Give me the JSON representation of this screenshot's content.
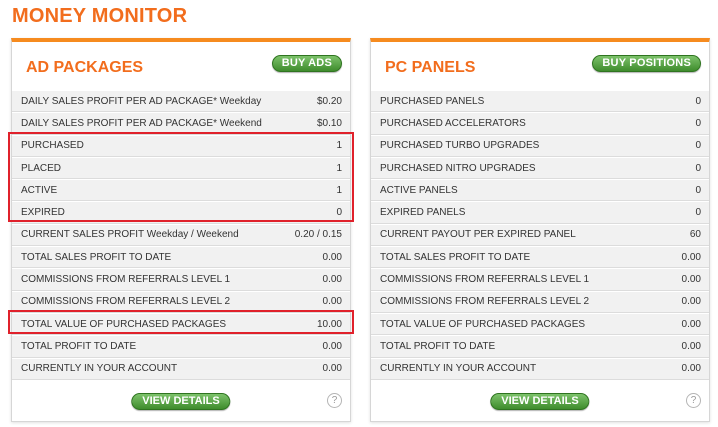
{
  "title": "MONEY MONITOR",
  "ad_packages": {
    "title": "AD PACKAGES",
    "buy_label": "BUY ADS",
    "rows": [
      {
        "label": "DAILY SALES PROFIT PER AD PACKAGE* Weekday",
        "value": "$0.20"
      },
      {
        "label": "DAILY SALES PROFIT PER AD PACKAGE* Weekend",
        "value": "$0.10"
      },
      {
        "label": "PURCHASED",
        "value": "1"
      },
      {
        "label": "PLACED",
        "value": "1"
      },
      {
        "label": "ACTIVE",
        "value": "1"
      },
      {
        "label": "EXPIRED",
        "value": "0"
      },
      {
        "label": "CURRENT SALES PROFIT Weekday / Weekend",
        "value": "0.20 / 0.15"
      },
      {
        "label": "TOTAL SALES PROFIT TO DATE",
        "value": "0.00"
      },
      {
        "label": "COMMISSIONS FROM REFERRALS LEVEL 1",
        "value": "0.00"
      },
      {
        "label": "COMMISSIONS FROM REFERRALS LEVEL 2",
        "value": "0.00"
      },
      {
        "label": "TOTAL VALUE OF PURCHASED PACKAGES",
        "value": "10.00"
      },
      {
        "label": "TOTAL PROFIT TO DATE",
        "value": "0.00"
      },
      {
        "label": "CURRENTLY IN YOUR ACCOUNT",
        "value": "0.00"
      }
    ],
    "details_label": "VIEW DETAILS",
    "help_glyph": "?"
  },
  "pc_panels": {
    "title": "PC PANELS",
    "buy_label": "BUY POSITIONS",
    "rows": [
      {
        "label": "PURCHASED PANELS",
        "value": "0"
      },
      {
        "label": "PURCHASED ACCELERATORS",
        "value": "0"
      },
      {
        "label": "PURCHASED TURBO UPGRADES",
        "value": "0"
      },
      {
        "label": "PURCHASED NITRO UPGRADES",
        "value": "0"
      },
      {
        "label": "ACTIVE PANELS",
        "value": "0"
      },
      {
        "label": "EXPIRED PANELS",
        "value": "0"
      },
      {
        "label": "CURRENT PAYOUT PER EXPIRED PANEL",
        "value": "60"
      },
      {
        "label": "TOTAL SALES PROFIT TO DATE",
        "value": "0.00"
      },
      {
        "label": "COMMISSIONS FROM REFERRALS LEVEL 1",
        "value": "0.00"
      },
      {
        "label": "COMMISSIONS FROM REFERRALS LEVEL 2",
        "value": "0.00"
      },
      {
        "label": "TOTAL VALUE OF PURCHASED PACKAGES",
        "value": "0.00"
      },
      {
        "label": "TOTAL PROFIT TO DATE",
        "value": "0.00"
      },
      {
        "label": "CURRENTLY IN YOUR ACCOUNT",
        "value": "0.00"
      }
    ],
    "details_label": "VIEW DETAILS",
    "help_glyph": "?"
  },
  "colors": {
    "accent": "#f26d1d",
    "button": "#4a9a38",
    "highlight": "#e0212b"
  }
}
